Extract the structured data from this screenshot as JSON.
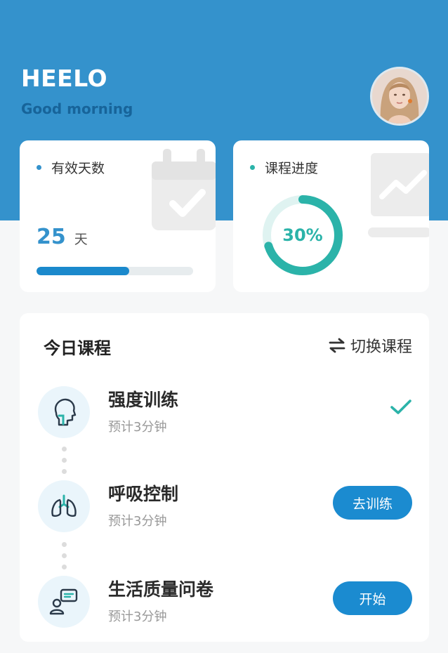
{
  "header": {
    "title": "HEELO",
    "subtitle": "Good morning"
  },
  "cards": {
    "days": {
      "label": "有效天数",
      "value": "25",
      "unit": "天",
      "progress": 0.59,
      "dot_color": "#3492cc",
      "bg_icon": "calendar-check-icon"
    },
    "progress": {
      "label": "课程进度",
      "value_text": "30%",
      "value": 0.7,
      "dot_color": "#2bb3a9",
      "bg_icon": "chart-line-icon"
    }
  },
  "today": {
    "title": "今日课程",
    "switch_label": "切换课程",
    "courses": [
      {
        "name": "强度训练",
        "desc": "预计3分钟",
        "icon": "head-profile-icon",
        "status": "done"
      },
      {
        "name": "呼吸控制",
        "desc": "预计3分钟",
        "icon": "lungs-icon",
        "action": "去训练"
      },
      {
        "name": "生活质量问卷",
        "desc": "预计3分钟",
        "icon": "questionnaire-user-icon",
        "action": "开始"
      }
    ]
  },
  "colors": {
    "primary": "#3492cc",
    "button": "#1b8bd0",
    "teal": "#2bb3a9"
  }
}
